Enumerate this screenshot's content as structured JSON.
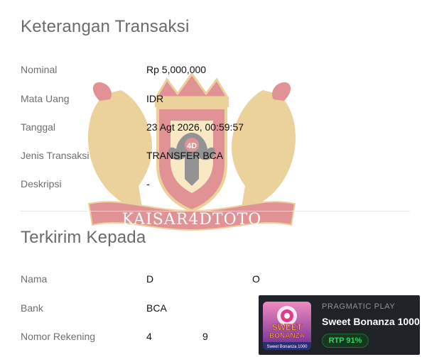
{
  "transaction_section": {
    "heading": "Keterangan Transaksi",
    "rows": [
      {
        "label": "Nominal",
        "value": "Rp 5,000,000"
      },
      {
        "label": "Mata Uang",
        "value": "IDR"
      },
      {
        "label": "Tanggal",
        "value": "23 Agt 2026, 00:59:57"
      },
      {
        "label": "Jenis Transaksi",
        "value": "TRANSFER BCA"
      },
      {
        "label": "Deskripsi",
        "value": "-"
      }
    ]
  },
  "recipient_section": {
    "heading": "Terkirim Kepada",
    "rows": [
      {
        "label": "Nama",
        "value_start": "D",
        "value_end": "O"
      },
      {
        "label": "Bank",
        "value": "BCA"
      },
      {
        "label": "Nomor Rekening",
        "value_start": "4",
        "value_end": "9"
      }
    ]
  },
  "watermark": {
    "brand_text": "KAISAR4DTOTO",
    "emblem_text": "4D",
    "colors": {
      "gold": "#d9a63a",
      "red": "#c2282e",
      "dark": "#2a2a2a"
    }
  },
  "game_card": {
    "provider": "PRAGMATIC PLAY",
    "title": "Sweet Bonanza 1000",
    "rtp": "RTP 91%",
    "thumb_logo_top": "SWEET",
    "thumb_logo_bottom": "BONANZA",
    "thumb_caption": "Sweet Bonanza 1000",
    "colors": {
      "card_bg": "#1f2227",
      "rtp_green": "#37d063",
      "thumb_pink": "#e23d8b"
    }
  }
}
